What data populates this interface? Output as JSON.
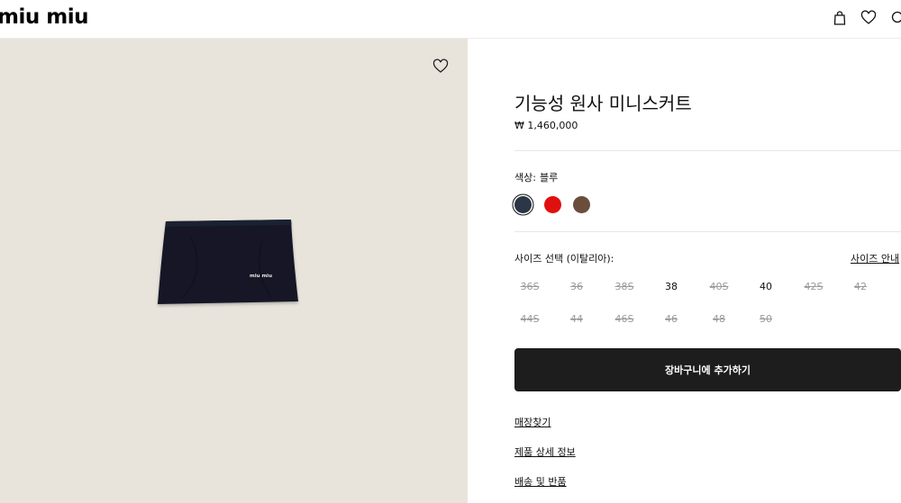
{
  "header": {
    "logo": "miu miu",
    "icons": [
      "bag-icon",
      "heart-icon",
      "search-icon"
    ]
  },
  "product": {
    "title": "기능성 원사 미니스커트",
    "price": "₩ 1,460,000",
    "color_label": "색상:",
    "color_value": "블루",
    "swatches": [
      {
        "name": "navy",
        "color": "#2b3647",
        "selected": true
      },
      {
        "name": "red",
        "color": "#e0100f",
        "selected": false
      },
      {
        "name": "brown",
        "color": "#6b4d3c",
        "selected": false
      }
    ],
    "size_label": "사이즈 선택 (이탈리아):",
    "size_guide": "사이즈 안내",
    "sizes": [
      {
        "label": "36S",
        "available": false
      },
      {
        "label": "36",
        "available": false
      },
      {
        "label": "38S",
        "available": false
      },
      {
        "label": "38",
        "available": true
      },
      {
        "label": "40S",
        "available": false
      },
      {
        "label": "40",
        "available": true
      },
      {
        "label": "42S",
        "available": false
      },
      {
        "label": "42",
        "available": false
      },
      {
        "label": "44S",
        "available": false
      },
      {
        "label": "44",
        "available": false
      },
      {
        "label": "46S",
        "available": false
      },
      {
        "label": "46",
        "available": false
      },
      {
        "label": "48",
        "available": false
      },
      {
        "label": "50",
        "available": false
      }
    ],
    "add_to_cart": "장바구니에 추가하기",
    "links": [
      "매장찾기",
      "제품 상세 정보",
      "배송 및 반품"
    ],
    "skirt_logo_text": "miu miu"
  },
  "colors": {
    "image_bg": "#e8e4dc",
    "skirt": "#121826",
    "button_bg": "#1d1d1d"
  }
}
